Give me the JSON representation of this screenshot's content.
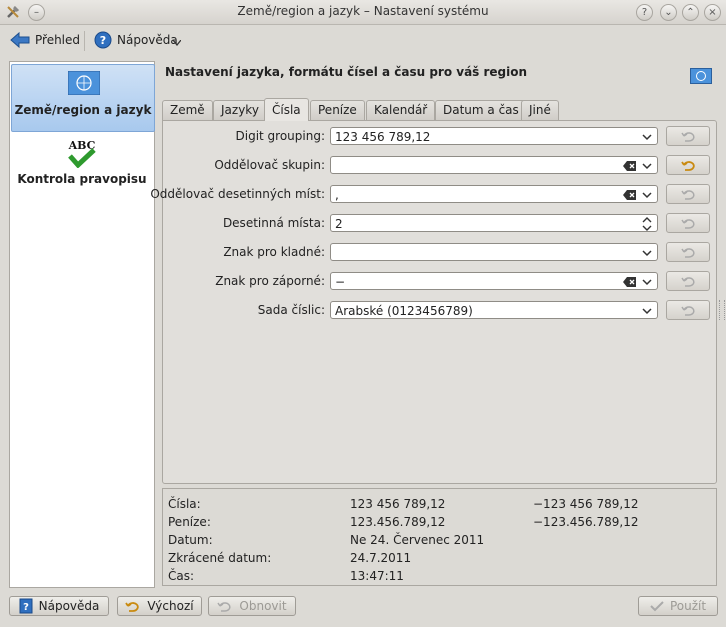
{
  "window": {
    "title": "Země/region a jazyk – Nastavení systému"
  },
  "toolbar": {
    "overview_label": "Přehled",
    "help_label": "Nápověda"
  },
  "sidebar": {
    "items": [
      {
        "label": "Země/region a jazyk",
        "icon": "un-flag-icon",
        "selected": true
      },
      {
        "label": "Kontrola pravopisu",
        "icon": "abc-check-icon",
        "selected": false
      }
    ]
  },
  "page": {
    "title": "Nastavení jazyka, formátu čísel a času pro váš region"
  },
  "tabs": [
    {
      "label": "Země",
      "active": false
    },
    {
      "label": "Jazyky",
      "active": false
    },
    {
      "label": "Čísla",
      "active": true
    },
    {
      "label": "Peníze",
      "active": false
    },
    {
      "label": "Kalendář",
      "active": false
    },
    {
      "label": "Datum a čas",
      "active": false
    },
    {
      "label": "Jiné",
      "active": false
    }
  ],
  "fields": [
    {
      "label": "Digit grouping:",
      "value": "123 456 789,12",
      "type": "select",
      "reset_enabled": false
    },
    {
      "label": "Oddělovač skupin:",
      "value": "",
      "type": "combo-clear",
      "reset_enabled": true
    },
    {
      "label": "Oddělovač desetinných míst:",
      "value": ",",
      "type": "combo-clear",
      "reset_enabled": false
    },
    {
      "label": "Desetinná místa:",
      "value": "2",
      "type": "spin",
      "reset_enabled": false
    },
    {
      "label": "Znak pro kladné:",
      "value": "",
      "type": "select",
      "reset_enabled": false
    },
    {
      "label": "Znak pro záporné:",
      "value": "−",
      "type": "combo-clear",
      "reset_enabled": false
    },
    {
      "label": "Sada číslic:",
      "value": "Arabské (0123456789)",
      "type": "select",
      "reset_enabled": false
    }
  ],
  "summary": [
    {
      "label": "Čísla:",
      "positive": "123 456 789,12",
      "negative": "−123 456 789,12"
    },
    {
      "label": "Peníze:",
      "positive": "123.456.789,12",
      "negative": "−123.456.789,12"
    },
    {
      "label": "Datum:",
      "positive": "Ne 24. Červenec 2011",
      "negative": ""
    },
    {
      "label": "Zkrácené datum:",
      "positive": "24.7.2011",
      "negative": ""
    },
    {
      "label": "Čas:",
      "positive": "13:47:11",
      "negative": ""
    }
  ],
  "buttons": {
    "help": "Nápověda",
    "defaults": "Výchozí",
    "reset": "Obnovit",
    "apply": "Použít"
  },
  "colors": {
    "selection": "#a8c9ee",
    "accent": "#2a6ebd",
    "check_green": "#2e9a2e"
  }
}
